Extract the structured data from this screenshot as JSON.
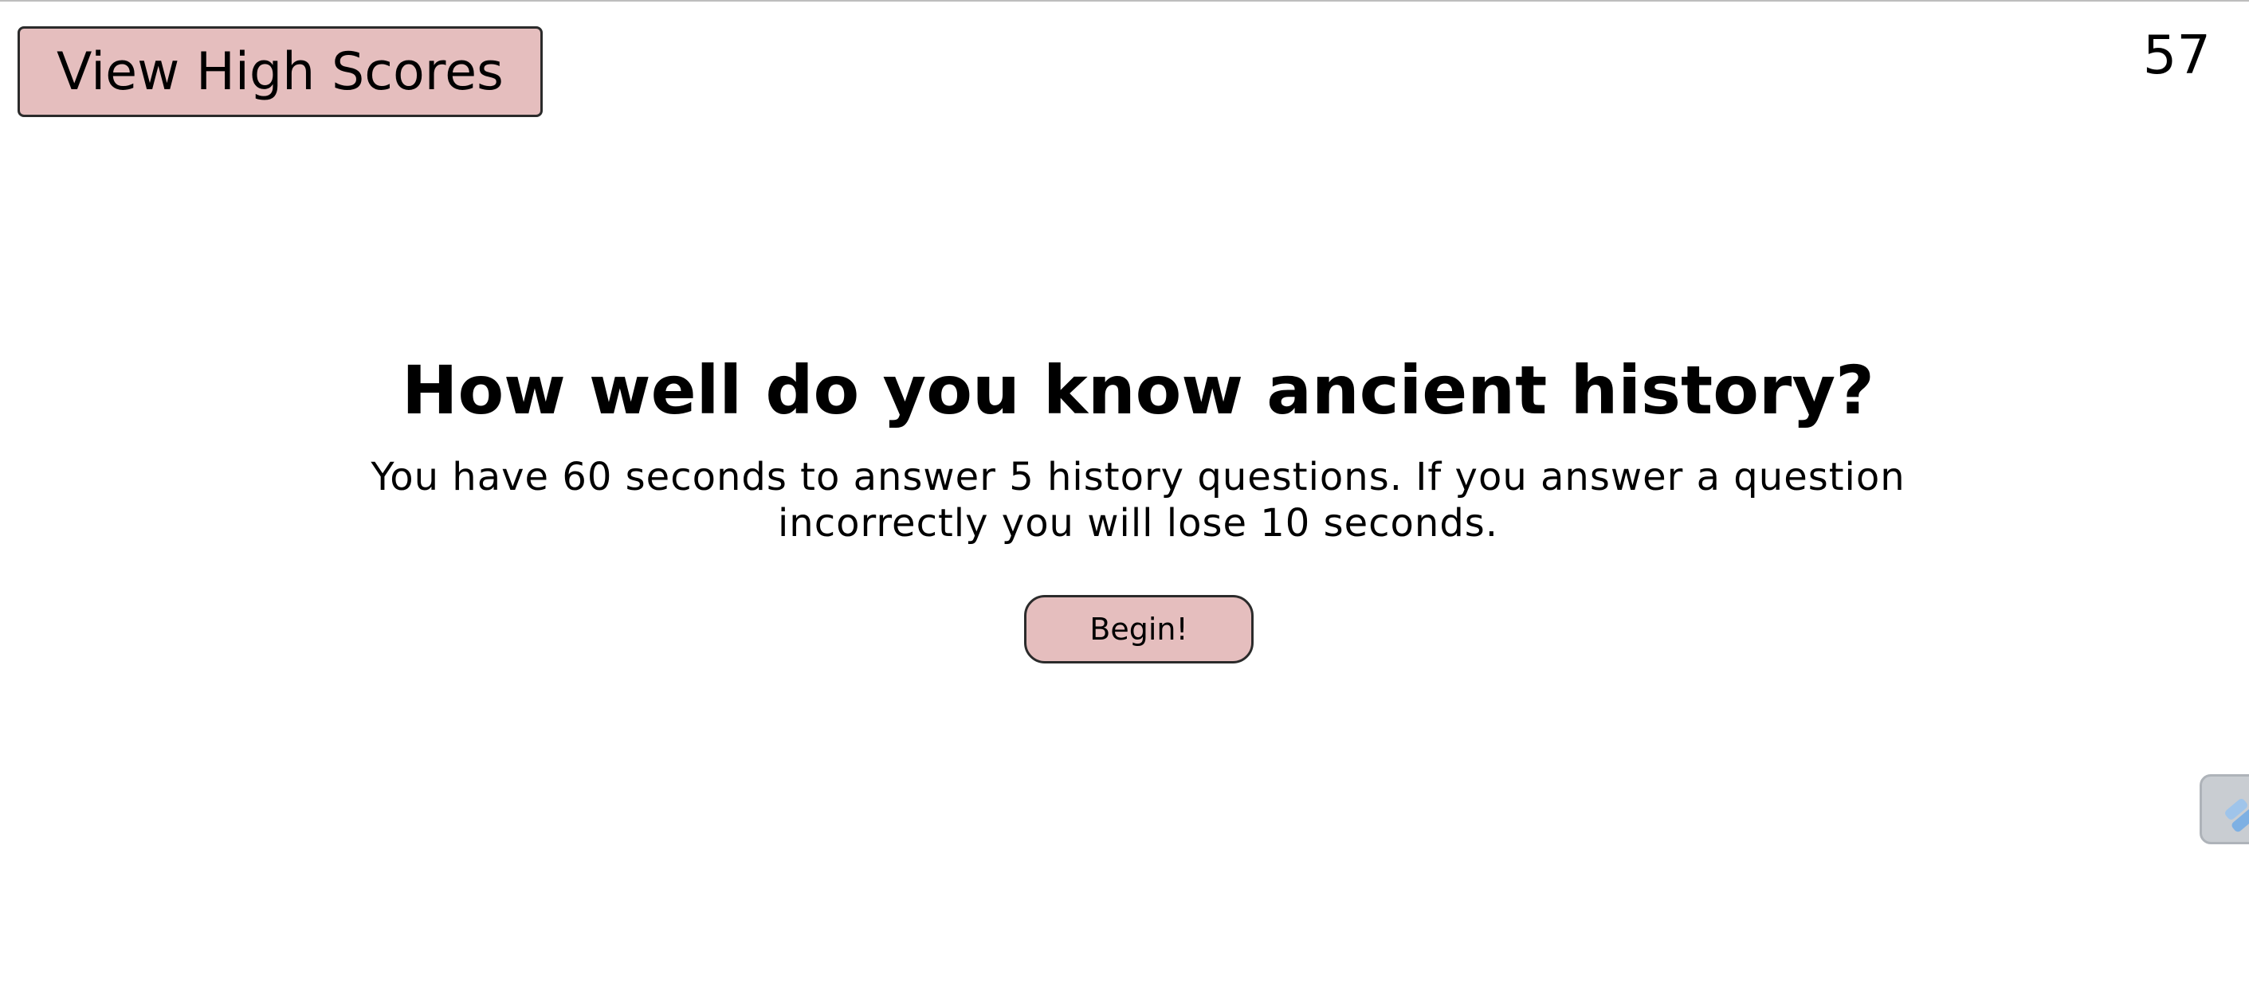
{
  "header": {
    "high_scores_label": "View High Scores",
    "timer_value": "57"
  },
  "intro": {
    "title": "How well do you know ancient history?",
    "description": "You have 60 seconds to answer 5 history questions. If you answer a question incorrectly you will lose 10 seconds.",
    "begin_label": "Begin!"
  },
  "widget": {
    "icon": "extension-tab-icon"
  },
  "colors": {
    "button_bg": "#e5bebe",
    "button_border": "#2b2b2b",
    "background": "#ffffff"
  }
}
